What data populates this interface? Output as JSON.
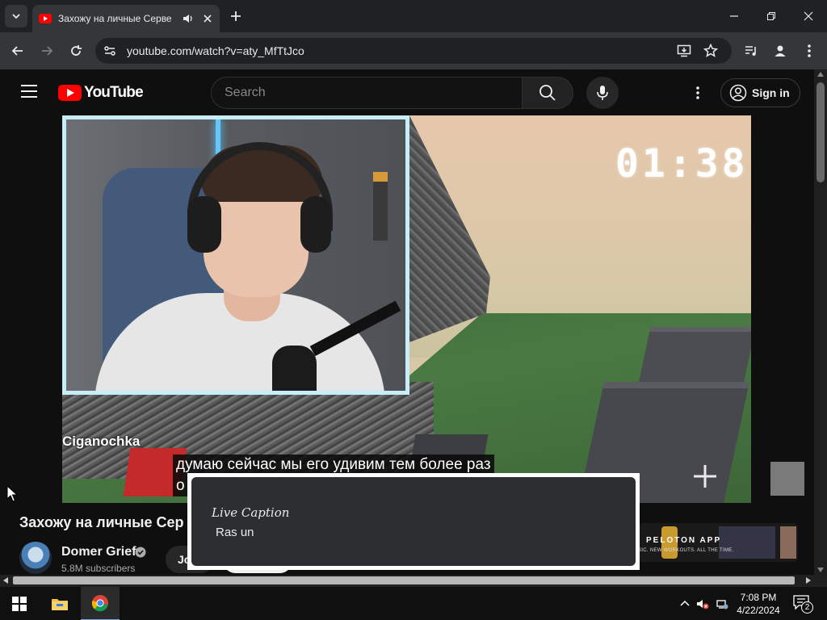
{
  "browser": {
    "tab": {
      "title": "Захожу на личные Серве"
    },
    "url": "youtube.com/watch?v=aty_MfTtJco"
  },
  "youtube": {
    "logo_text": "YouTube",
    "search_placeholder": "Search",
    "signin_label": "Sign in"
  },
  "video": {
    "timer": "01:38",
    "streamer_name": "Ciganochka",
    "subtitle_line1": "думаю сейчас мы его удивим тем более раз",
    "subtitle_line2": "о"
  },
  "video_info": {
    "title": "Захожу на личные Сер",
    "channel_name": "Domer Grief",
    "subscribers": "5.8M subscribers",
    "join_label": "Jo",
    "ad_text": "PELOTON APP",
    "ad_subtext": "SIC. NEW WORKOUTS. ALL THE TIME."
  },
  "live_caption": {
    "title": "Live Caption",
    "text": "Ras un"
  },
  "taskbar": {
    "time": "7:08 PM",
    "date": "4/22/2024",
    "notification_count": "2"
  },
  "colors": {
    "youtube_red": "#ff0000",
    "chrome_dark": "#202124",
    "page_bg": "#0f0f0f"
  }
}
